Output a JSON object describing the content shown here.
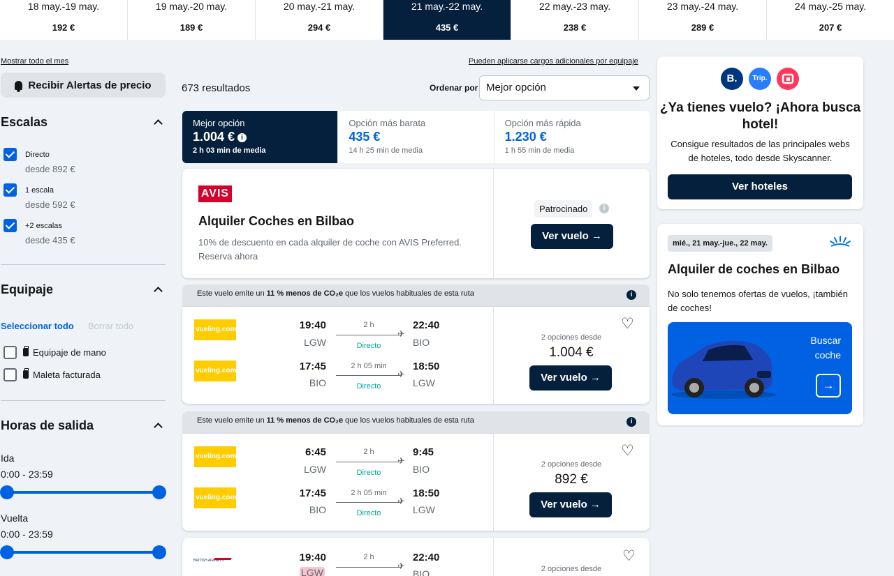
{
  "dates": [
    {
      "range": "18 may.-19 may.",
      "price": "192 €",
      "active": false
    },
    {
      "range": "19 may.-20 may.",
      "price": "189 €",
      "active": false
    },
    {
      "range": "20 may.-21 may.",
      "price": "294 €",
      "active": false
    },
    {
      "range": "21 may.-22 may.",
      "price": "435 €",
      "active": true
    },
    {
      "range": "22 may.-23 may.",
      "price": "238 €",
      "active": false
    },
    {
      "range": "23 may.-24 may.",
      "price": "289 €",
      "active": false
    },
    {
      "range": "24 may.-25 may.",
      "price": "207 €",
      "active": false
    }
  ],
  "sidebar": {
    "show_month": "Mostrar todo el mes",
    "alerts_button": "Recibir Alertas de precio",
    "stops": {
      "title": "Escalas",
      "options": [
        {
          "label": "Directo",
          "sub": "desde 892 €",
          "checked": true
        },
        {
          "label": "1 escala",
          "sub": "desde 592 €",
          "checked": true
        },
        {
          "label": "+2 escalas",
          "sub": "desde 435 €",
          "checked": true
        }
      ]
    },
    "baggage": {
      "title": "Equipaje",
      "select_all": "Seleccionar todo",
      "clear_all": "Borrar todo",
      "options": [
        {
          "label": "Equipaje de mano",
          "checked": false
        },
        {
          "label": "Maleta facturada",
          "checked": false
        }
      ]
    },
    "times": {
      "title": "Horas de salida",
      "outbound_label": "Ida",
      "outbound_range": "0:00 - 23:59",
      "return_label": "Vuelta",
      "return_range": "0:00 - 23:59"
    }
  },
  "main": {
    "extra_fees": "Pueden aplicarse cargos adicionales por equipaje",
    "results": "673 resultados",
    "sort_label": "Ordenar por",
    "sort_value": "Mejor opción",
    "tabs": [
      {
        "label": "Mejor opción",
        "price": "1.004 €",
        "time": "2 h 03 min de media",
        "active": true
      },
      {
        "label": "Opción más barata",
        "price": "435 €",
        "time": "14 h 25 min de media",
        "active": false
      },
      {
        "label": "Opción más rápida",
        "price": "1.230 €",
        "time": "1 h 55 min de media",
        "active": false
      }
    ],
    "ad": {
      "logo": "AVIS",
      "title": "Alquiler Coches en Bilbao",
      "desc": "10% de descuento en cada alquiler de coche con AVIS Preferred. Reserva ahora",
      "sponsored": "Patrocinado",
      "button": "Ver vuelo →"
    },
    "eco_text_pre": "Este vuelo emite un ",
    "eco_text_pct": "11 % menos de CO₂e",
    "eco_text_post": " que los vuelos habituales de esta ruta",
    "flights": [
      {
        "legs": [
          {
            "airline": "vueling.com",
            "dep": "19:40",
            "from": "LGW",
            "dur": "2 h",
            "type": "Directo",
            "arr": "22:40",
            "to": "BIO"
          },
          {
            "airline": "vueling.com",
            "dep": "17:45",
            "from": "BIO",
            "dur": "2 h 05 min",
            "type": "Directo",
            "arr": "18:50",
            "to": "LGW"
          }
        ],
        "options": "2 opciones desde",
        "price": "1.004 €",
        "button": "Ver vuelo →"
      },
      {
        "legs": [
          {
            "airline": "vueling.com",
            "dep": "6:45",
            "from": "LGW",
            "dur": "2 h",
            "type": "Directo",
            "arr": "9:45",
            "to": "BIO"
          },
          {
            "airline": "vueling.com",
            "dep": "17:45",
            "from": "BIO",
            "dur": "2 h 05 min",
            "type": "Directo",
            "arr": "18:50",
            "to": "LGW"
          }
        ],
        "options": "2 opciones desde",
        "price": "892 €",
        "button": "Ver vuelo →"
      },
      {
        "legs": [
          {
            "airline": "BRITISH AIRWAYS",
            "dep": "19:40",
            "from": "LGW",
            "dur": "2 h",
            "type": "",
            "arr": "22:40",
            "to": "BIO"
          }
        ],
        "options": "2 opciones desde"
      }
    ]
  },
  "right": {
    "hotel_logos": [
      "B.",
      "Trip.",
      ""
    ],
    "hotel_title": "¿Ya tienes vuelo? ¡Ahora busca hotel!",
    "hotel_sub": "Consigue resultados de las principales webs de hoteles, todo desde Skyscanner.",
    "hotel_button": "Ver hoteles",
    "car_dates": "mié., 21 may.-jue., 22 may.",
    "car_title": "Alquiler de coches en Bilbao",
    "car_sub": "No solo tenemos ofertas de vuelos, ¡también de coches!",
    "car_cta": "Buscar coche",
    "car_arrow": "→"
  },
  "colors": {
    "primary_dark": "#05203c",
    "accent_blue": "#0062e3",
    "eco_green": "#00a698",
    "vueling_yellow": "#ffcc00",
    "avis_red": "#d4002a"
  }
}
